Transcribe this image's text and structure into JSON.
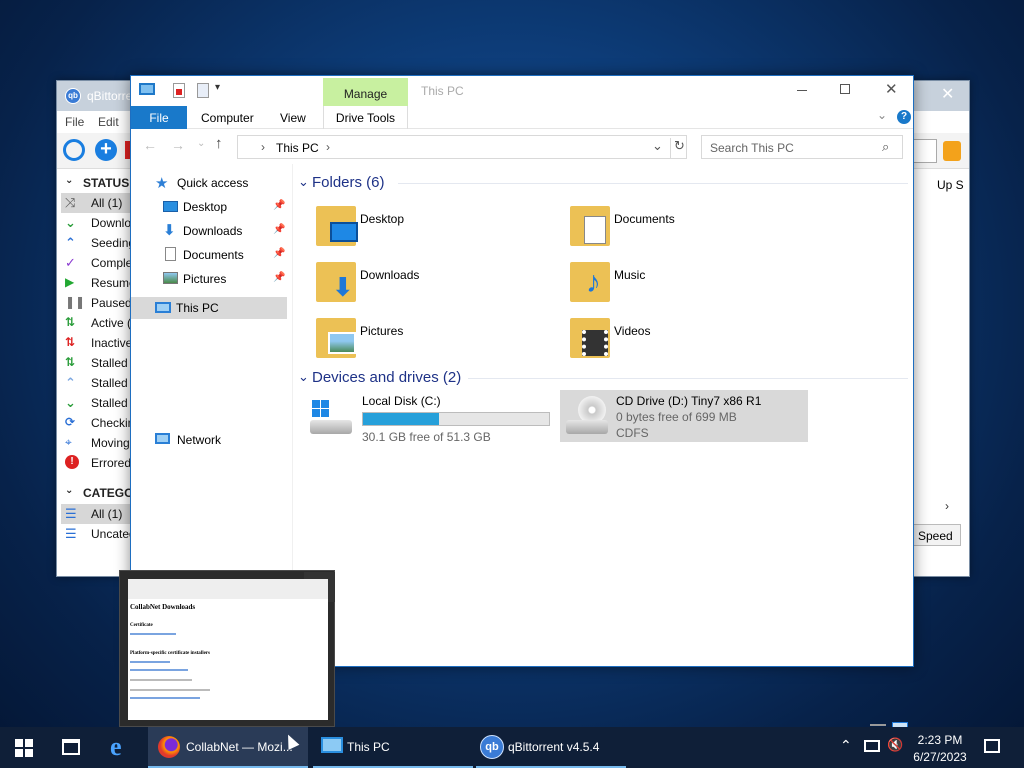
{
  "qbittorrent": {
    "title": "qBittorrent",
    "menu": [
      "File",
      "Edit"
    ],
    "status_header": "STATUS",
    "status_items": [
      "All (1)",
      "Downlo",
      "Seeding",
      "Comple",
      "Resume",
      "Paused",
      "Active (",
      "Inactive",
      "Stalled",
      "Stalled",
      "Stalled",
      "Checkin",
      "Moving",
      "Errored"
    ],
    "categories_header": "CATEGO",
    "category_items": [
      "All (1)",
      "Uncateg"
    ],
    "column_up_speed": "Up S",
    "speed_tab": "Speed"
  },
  "explorer": {
    "manage_tab": "Manage",
    "window_title": "This PC",
    "ribbon_tabs": [
      "File",
      "Computer",
      "View",
      "Drive Tools"
    ],
    "breadcrumb": "This PC",
    "search_placeholder": "Search This PC",
    "nav": {
      "quick_access": "Quick access",
      "pinned": [
        "Desktop",
        "Downloads",
        "Documents",
        "Pictures"
      ],
      "this_pc": "This PC",
      "network": "Network"
    },
    "folders_header": "Folders (6)",
    "folders": [
      "Desktop",
      "Documents",
      "Downloads",
      "Music",
      "Pictures",
      "Videos"
    ],
    "devices_header": "Devices and drives (2)",
    "drives": [
      {
        "name": "Local Disk (C:)",
        "free": "30.1 GB free of 51.3 GB",
        "used_fraction": 0.41
      },
      {
        "name": "CD Drive (D:) Tiny7 x86 R1",
        "free": "0 bytes free of 699 MB",
        "fs": "CDFS"
      }
    ]
  },
  "thumbnail": {
    "heading": "CollabNet Downloads",
    "line1": "Certificate",
    "line2": "Platform-specific certificate installers"
  },
  "taskbar": {
    "firefox": "CollabNet — Mozi...",
    "explorer": "This PC",
    "qbittorrent": "qBittorrent v4.5.4",
    "time": "2:23 PM",
    "date": "6/27/2023"
  },
  "colors": {
    "accent": "#1979ca",
    "manage_tab": "#c8f0a0",
    "drive_bar": "#26a0da",
    "folder": "#ecc155",
    "selection": "#cce8ff"
  }
}
